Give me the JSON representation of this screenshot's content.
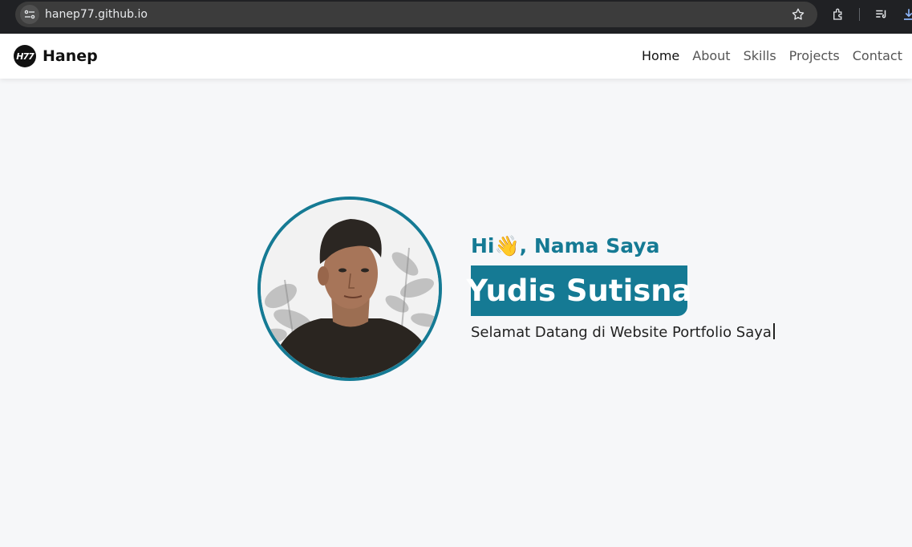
{
  "browser": {
    "url": "hanep77.github.io",
    "icons": [
      "site-info-icon",
      "bookmark-star-icon",
      "extensions-icon",
      "reading-list-icon",
      "download-icon"
    ]
  },
  "navbar": {
    "logo_text": "H77",
    "brand": "Hanep",
    "links": [
      {
        "label": "Home",
        "active": true
      },
      {
        "label": "About",
        "active": false
      },
      {
        "label": "Skills",
        "active": false
      },
      {
        "label": "Projects",
        "active": false
      },
      {
        "label": "Contact",
        "active": false
      }
    ]
  },
  "hero": {
    "greeting_prefix": "Hi",
    "wave_emoji": "👋",
    "greeting_suffix": ", Nama Saya",
    "name": "Yudis Sutisna",
    "welcome": "Selamat Datang di Website Portfolio Saya"
  },
  "colors": {
    "accent": "#157a94",
    "page_bg": "#f6f7f9",
    "chrome_bg": "#202124"
  }
}
